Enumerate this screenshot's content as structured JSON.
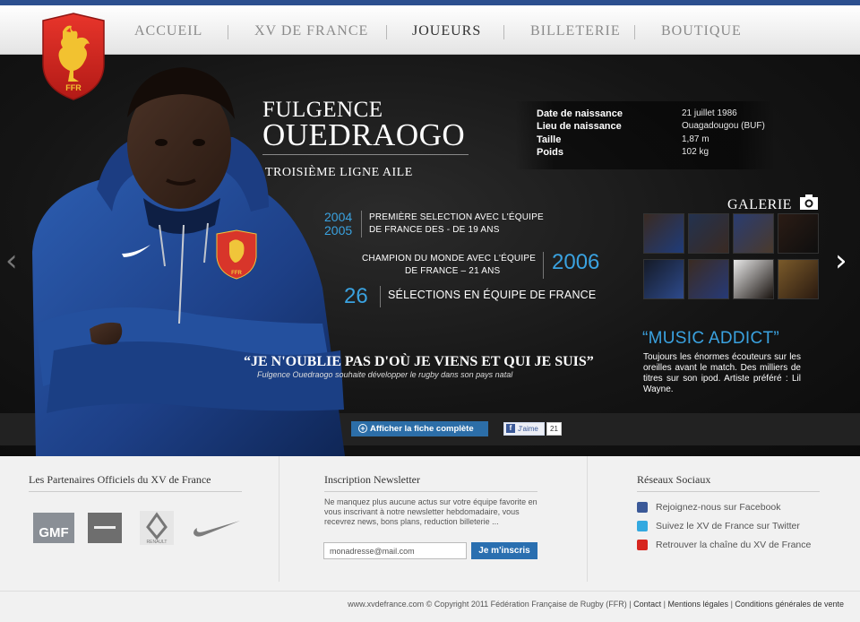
{
  "colors": {
    "accent": "#3aa2e0",
    "topline": "#2c4f8f",
    "button": "#2a6fb0"
  },
  "logo": {
    "text": "FFR"
  },
  "nav": {
    "items": [
      {
        "label": "ACCUEIL"
      },
      {
        "label": "XV DE FRANCE"
      },
      {
        "label": "JOUEURS"
      },
      {
        "label": "BILLETERIE"
      },
      {
        "label": "BOUTIQUE"
      }
    ],
    "active_index": 2
  },
  "player": {
    "first_name": "FULGENCE",
    "last_name": "OUEDRAOGO",
    "position": "TROISIÈME LIGNE AILE",
    "jersey_badge": "FFR"
  },
  "info": {
    "rows": [
      {
        "label": "Date de naissance",
        "value": "21 juillet 1986"
      },
      {
        "label": "Lieu de naissance",
        "value": "Ouagadougou (BUF)"
      },
      {
        "label": "Taille",
        "value": "1,87 m"
      },
      {
        "label": "Poids",
        "value": "102 kg"
      }
    ]
  },
  "facts": {
    "first_selection": {
      "year1": "2004",
      "year2": "2005",
      "line1": "PREMIÈRE SELECTION AVEC L'ÉQUIPE",
      "line2": "DE FRANCE DES - DE 19 ANS"
    },
    "champion": {
      "year": "2006",
      "line1": "CHAMPION DU MONDE AVEC L'ÉQUIPE",
      "line2": "DE FRANCE – 21 ANS"
    },
    "selections": {
      "number": "26",
      "text": "SÉLECTIONS EN ÉQUIPE DE FRANCE"
    }
  },
  "quote": {
    "text": "“JE N'OUBLIE PAS D'OÙ JE VIENS ET QUI JE SUIS”",
    "sub": "Fulgence Ouedraogo souhaite développer le rugby dans son pays natal"
  },
  "galerie": {
    "title": "GALERIE",
    "icon": "camera-icon"
  },
  "music": {
    "title": "“MUSIC ADDICT”",
    "text": "Toujours les énormes écouteurs sur les oreilles avant le match. Des milliers de titres sur son ipod. Artiste préféré : Lil Wayne."
  },
  "actions": {
    "fiche_label": "Afficher la fiche complète",
    "like_label": "J'aime",
    "like_count": "21"
  },
  "partners": {
    "title": "Les Partenaires Officiels du XV de France",
    "gmf": "GMF",
    "renault": "RENAULT"
  },
  "newsletter": {
    "title": "Inscription Newsletter",
    "text": "Ne manquez plus aucune actus sur votre équipe favorite en vous inscrivant à notre newsletter hebdomadaire, vous recevrez news, bons plans, reduction billeterie ...",
    "email_value": "monadresse@mail.com",
    "button_label": "Je m'inscris"
  },
  "social": {
    "title": "Réseaux Sociaux",
    "facebook": "Rejoignez-nous sur Facebook",
    "twitter": "Suivez le XV de France sur Twitter",
    "youtube": "Retrouver la chaîne du XV de France"
  },
  "footer": {
    "copyright": "www.xvdefrance.com © Copyright 2011 Fédération Française de Rugby (FFR)",
    "contact": "Contact",
    "legal": "Mentions légales",
    "conditions": "Conditions générales de vente"
  }
}
